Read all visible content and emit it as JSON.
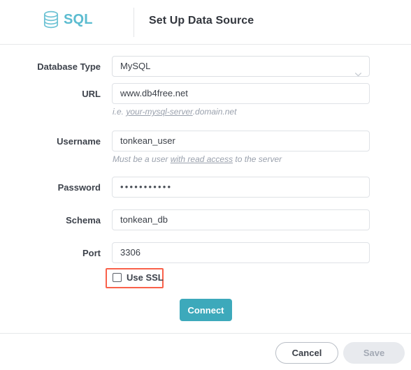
{
  "header": {
    "logo_text": "SQL",
    "logo_icon": "database-cylinder-icon",
    "title": "Set Up Data Source",
    "accent_color": "#5bbcd0"
  },
  "form": {
    "fields": [
      {
        "key": "database_type",
        "label": "Database Type",
        "type": "select",
        "value": "MySQL",
        "placeholder": "",
        "hint": "",
        "icon": "chevron-down-icon"
      },
      {
        "key": "url",
        "label": "URL",
        "type": "text",
        "value": "www.db4free.net",
        "placeholder": "",
        "hint_prefix": "i.e. ",
        "hint_underlined": "your-mysql-server",
        "hint_suffix": ".domain.net"
      },
      {
        "key": "username",
        "label": "Username",
        "type": "text",
        "value": "tonkean_user",
        "placeholder": "",
        "hint_prefix": "Must be a user ",
        "hint_underlined": "with read access",
        "hint_suffix": " to the server"
      },
      {
        "key": "password",
        "label": "Password",
        "type": "password",
        "value": "•••••••••••",
        "placeholder": "",
        "hint": ""
      },
      {
        "key": "schema",
        "label": "Schema",
        "type": "text",
        "value": "tonkean_db",
        "placeholder": "",
        "hint": ""
      },
      {
        "key": "port",
        "label": "Port",
        "type": "text",
        "value": "3306",
        "placeholder": "",
        "hint": ""
      }
    ],
    "ssl": {
      "label": "Use SSL",
      "checked": false,
      "highlight_color": "#f9614a"
    },
    "connect_button": {
      "label": "Connect",
      "color": "#3da9bb"
    }
  },
  "footer": {
    "cancel_label": "Cancel",
    "save_label": "Save",
    "save_disabled": true
  }
}
